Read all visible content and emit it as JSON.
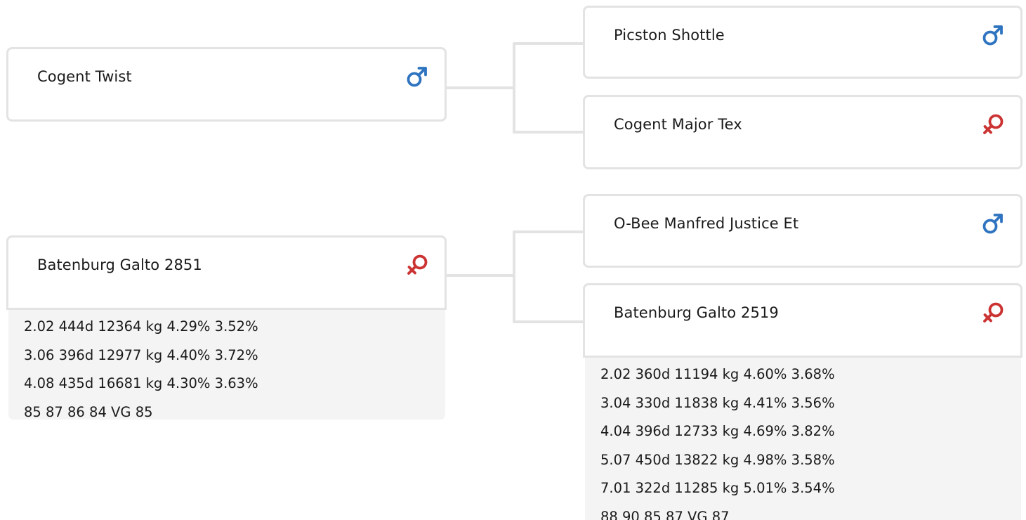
{
  "pedigree": {
    "sire": {
      "name": "Cogent Twist",
      "sex_icon": "male-icon",
      "sex_color": "#2f74c0",
      "sire": {
        "name": "Picston Shottle",
        "sex_icon": "male-icon",
        "sex_color": "#2f74c0"
      },
      "dam": {
        "name": "Cogent Major Tex",
        "sex_icon": "female-icon",
        "sex_color": "#cc3333"
      }
    },
    "dam": {
      "name": "Batenburg Galto 2851",
      "sex_icon": "female-icon",
      "sex_color": "#cc3333",
      "lactations": [
        "2.02 444d 12364 kg 4.29% 3.52%",
        "3.06 396d 12977 kg 4.40% 3.72%",
        "4.08 435d 16681 kg 4.30% 3.63%",
        "85 87 86 84 VG 85"
      ],
      "sire": {
        "name": "O-Bee Manfred Justice Et",
        "sex_icon": "male-icon",
        "sex_color": "#2f74c0"
      },
      "dam": {
        "name": "Batenburg Galto 2519",
        "sex_icon": "female-icon",
        "sex_color": "#cc3333",
        "lactations": [
          "2.02 360d 11194 kg 4.60% 3.68%",
          "3.04 330d 11838 kg 4.41% 3.56%",
          "4.04 396d 12733 kg 4.69% 3.82%",
          "5.07 450d 13822 kg 4.98% 3.58%",
          "7.01 322d 11285 kg 5.01% 3.54%",
          "88 90 85 87 VG 87"
        ]
      }
    }
  }
}
